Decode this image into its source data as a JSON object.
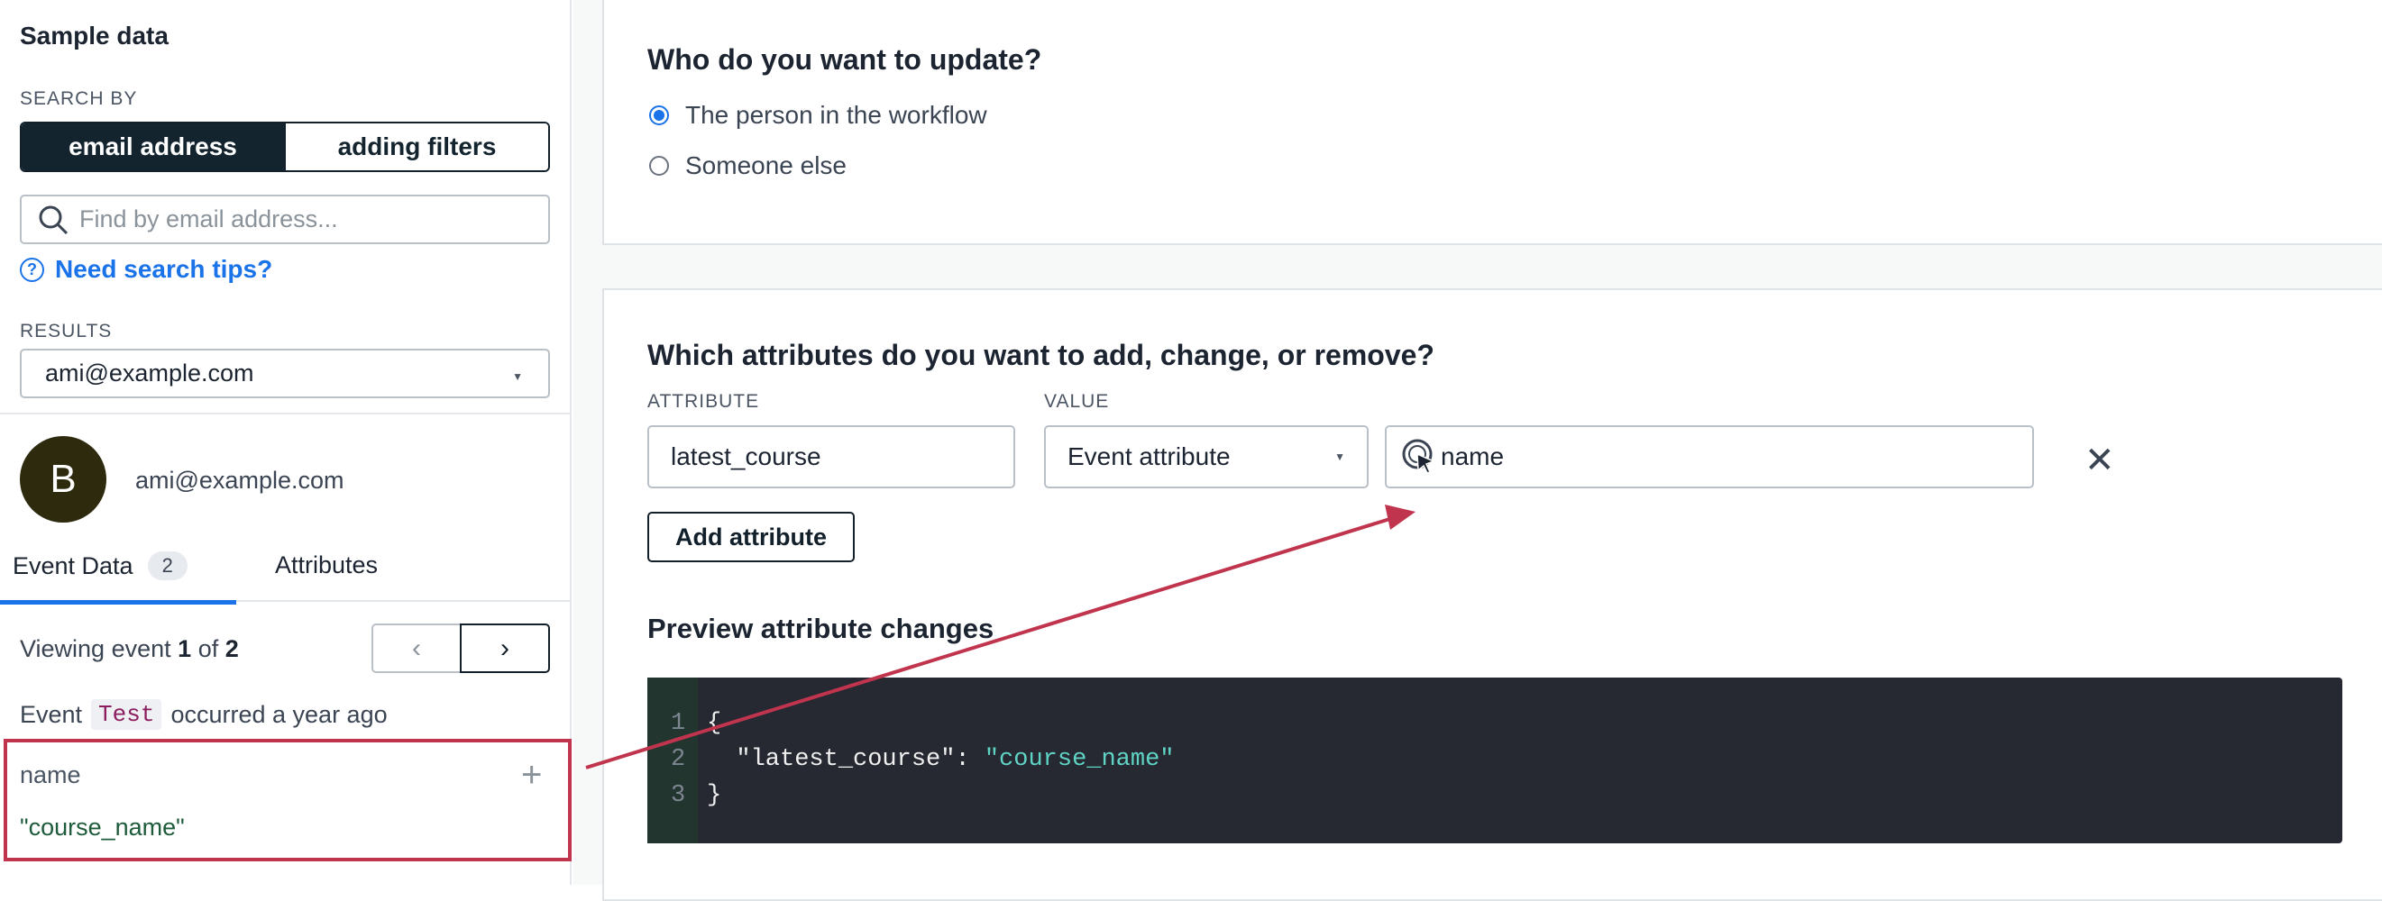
{
  "sidebar": {
    "title": "Sample data",
    "search_by_label": "SEARCH BY",
    "segments": {
      "email": "email address",
      "filters": "adding filters"
    },
    "search_placeholder": "Find by email address...",
    "tips_link": "Need search tips?",
    "results_label": "RESULTS",
    "results_value": "ami@example.com",
    "avatar_initial": "B",
    "profile_email": "ami@example.com",
    "tabs": {
      "event_data": "Event Data",
      "event_count": "2",
      "attributes": "Attributes"
    },
    "viewing": {
      "prefix": "Viewing event",
      "current": "1",
      "of": "of",
      "total": "2"
    },
    "event": {
      "prefix": "Event",
      "name": "Test",
      "suffix": "occurred a year ago"
    },
    "property": {
      "name": "name",
      "value": "\"course_name\""
    }
  },
  "main": {
    "who": {
      "heading": "Who do you want to update?",
      "options": [
        "The person in the workflow",
        "Someone else"
      ]
    },
    "attrs": {
      "heading": "Which attributes do you want to add, change, or remove?",
      "attribute_label": "ATTRIBUTE",
      "value_label": "VALUE",
      "attribute_value": "latest_course",
      "value_type": "Event attribute",
      "value_field": "name",
      "add_button": "Add attribute",
      "preview_heading": "Preview attribute changes",
      "code": {
        "line1": "{",
        "line2_key": "  \"latest_course\": ",
        "line2_val": "\"course_name\"",
        "line3": "}"
      }
    }
  },
  "colors": {
    "accent": "#1a73e8",
    "highlight": "#c0344e",
    "dark": "#13242f"
  }
}
